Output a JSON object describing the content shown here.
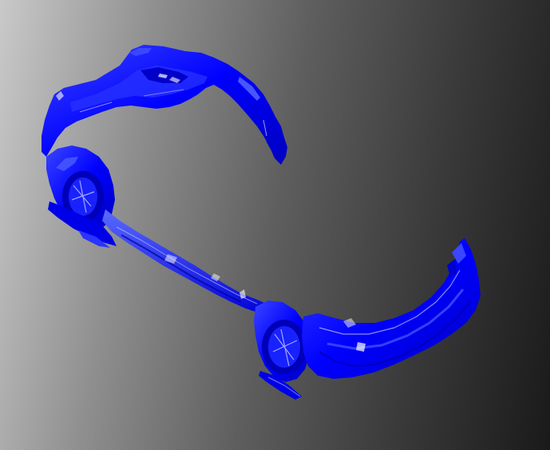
{
  "viewer": {
    "background_gradient": [
      "#c9c9c9",
      "#8f8f8f",
      "#5e5e5e",
      "#3a3a3a",
      "#1a1a1a"
    ],
    "mesh_color": "#0000ff",
    "mesh_highlight": "#4a5cff",
    "mesh_shadow": "#0000a8",
    "edge_color": "#ffffff"
  }
}
